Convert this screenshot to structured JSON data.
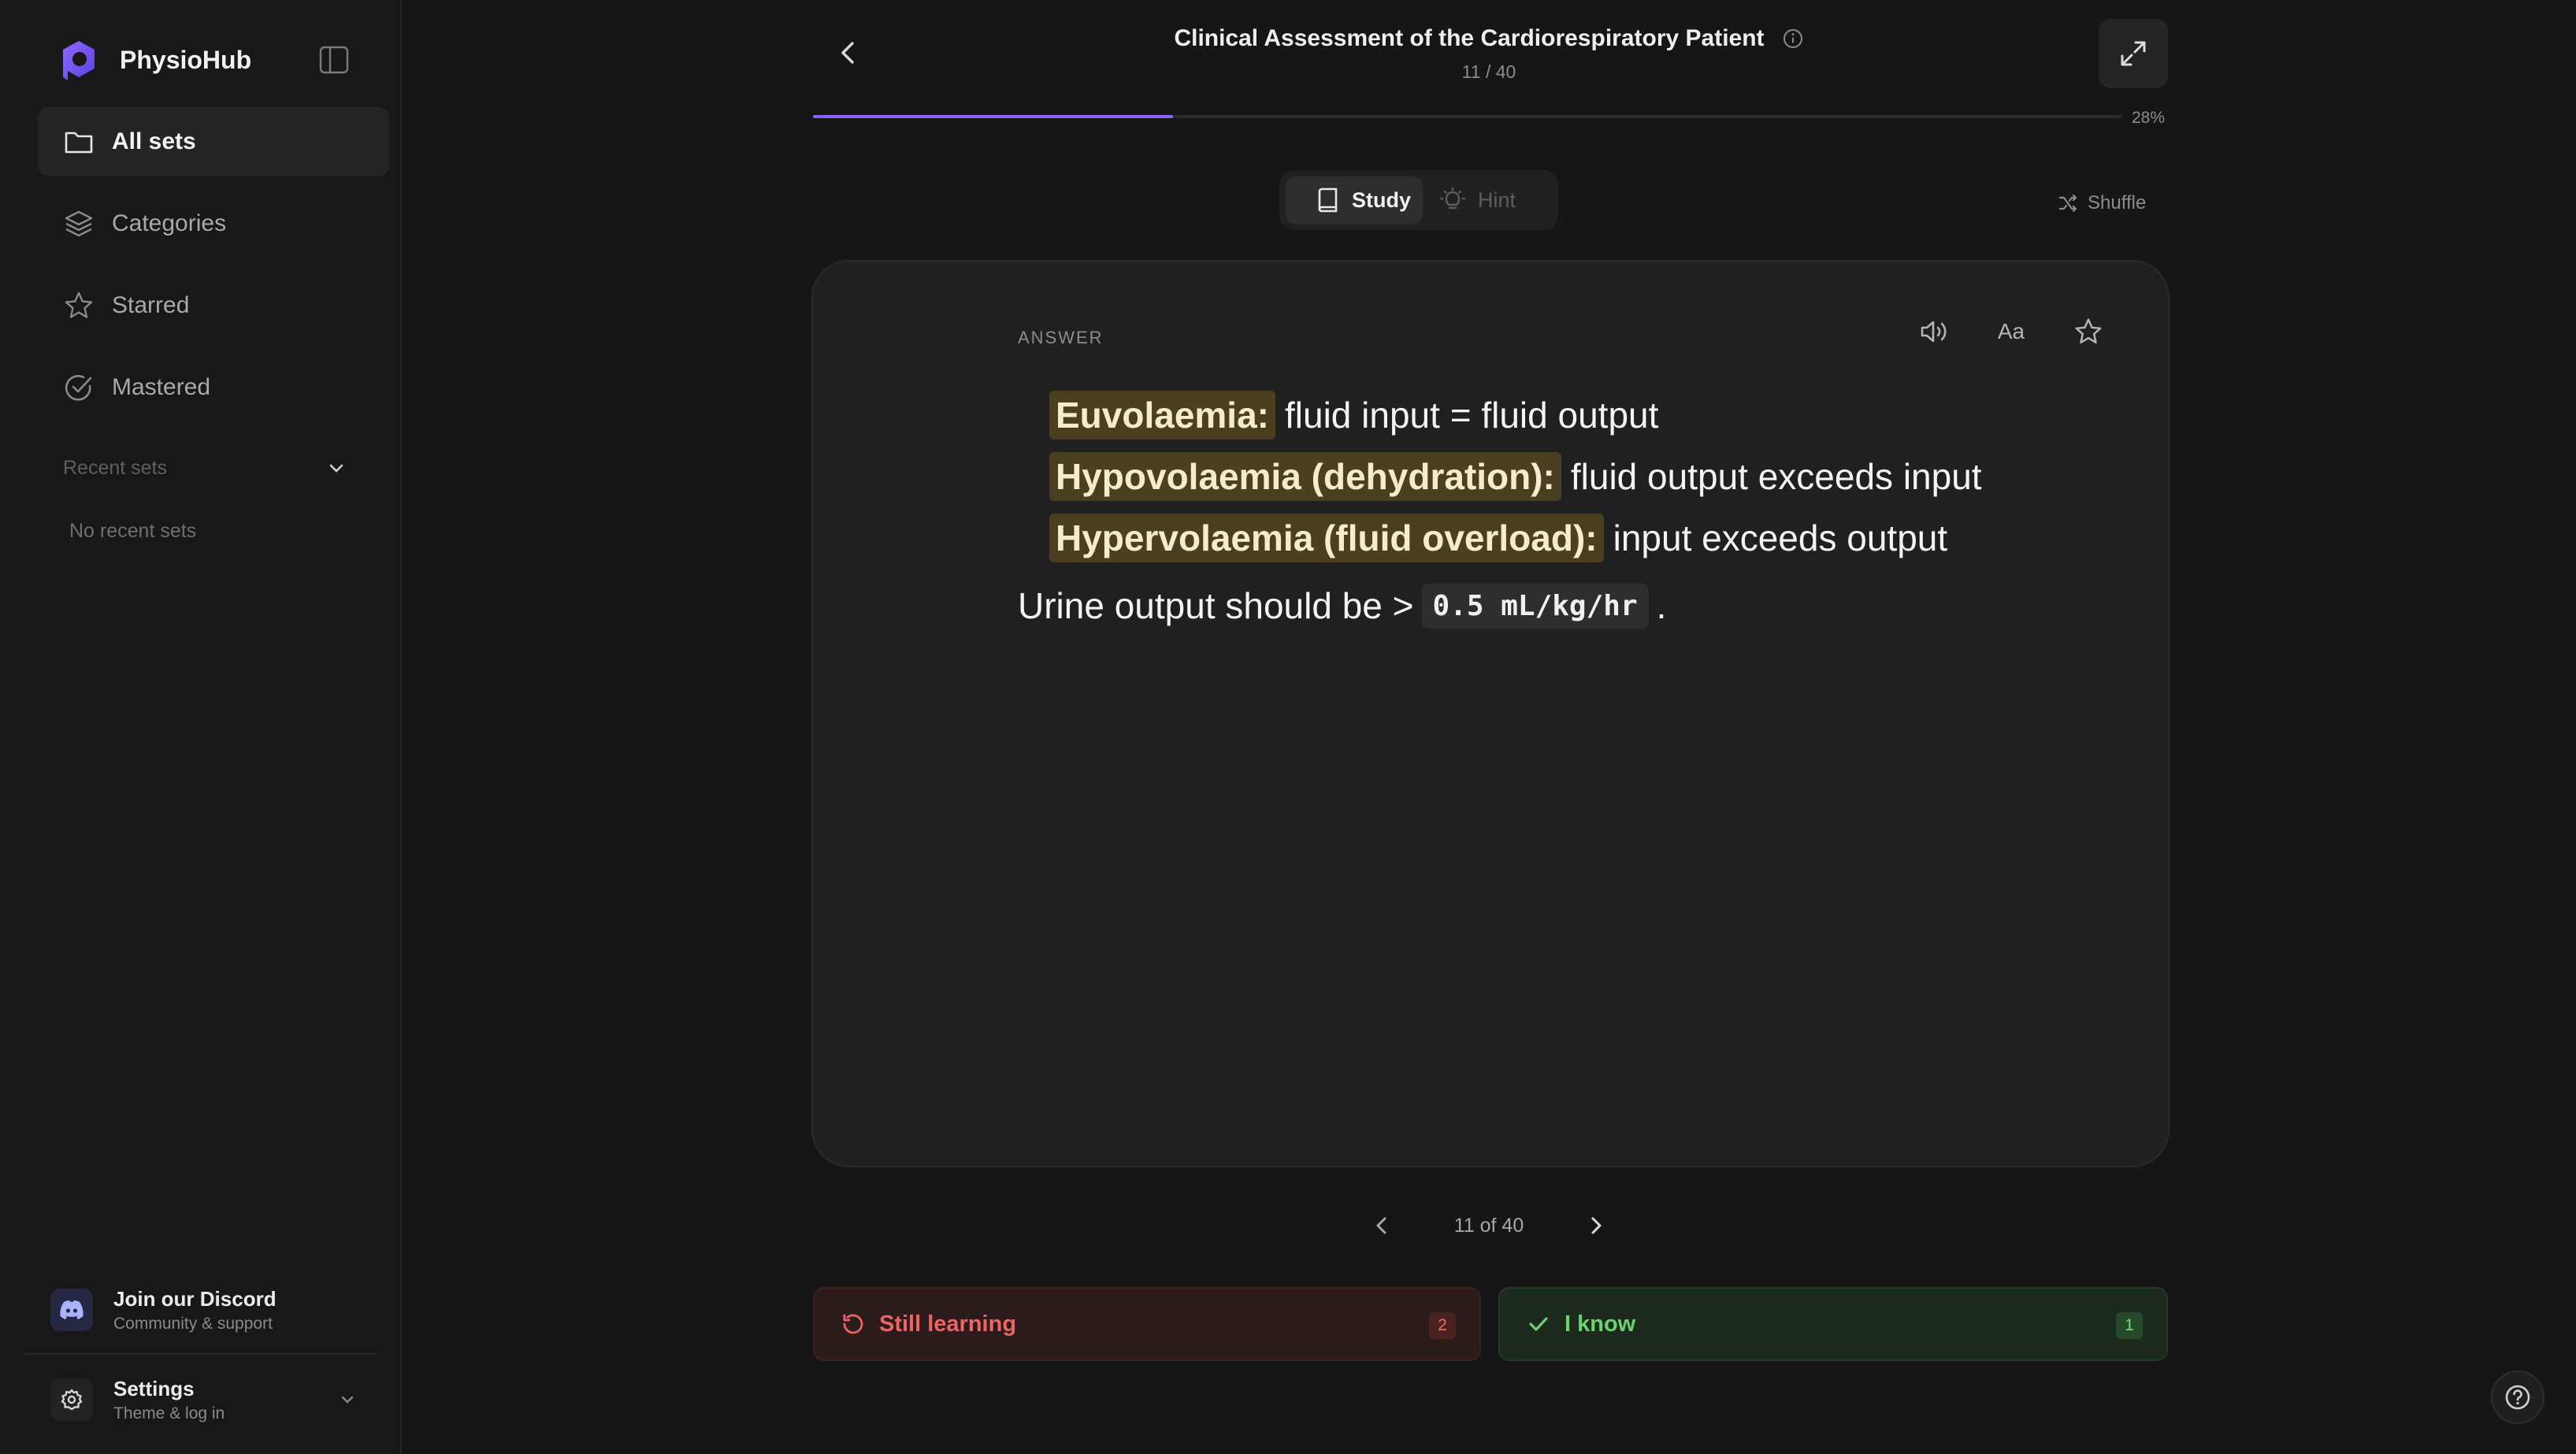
{
  "app": {
    "name": "PhysioHub",
    "brand_color": "#7c5cff"
  },
  "sidebar": {
    "items": [
      {
        "label": "All sets",
        "icon": "folder-icon",
        "active": true
      },
      {
        "label": "Categories",
        "icon": "layers-icon",
        "active": false
      },
      {
        "label": "Starred",
        "icon": "star-icon",
        "active": false
      },
      {
        "label": "Mastered",
        "icon": "check-circle-icon",
        "active": false
      }
    ],
    "recent_title": "Recent sets",
    "recent_empty": "No recent sets",
    "discord": {
      "title": "Join our Discord",
      "subtitle": "Community & support"
    },
    "settings": {
      "title": "Settings",
      "subtitle": "Theme & log in"
    }
  },
  "header": {
    "title": "Clinical Assessment of the Cardiorespiratory Patient",
    "counter": "11 / 40",
    "progress_pct": "28%",
    "progress_fraction": 0.275
  },
  "modes": {
    "study": "Study",
    "hint": "Hint",
    "shuffle": "Shuffle"
  },
  "card": {
    "label": "ANSWER",
    "font_tool": "Aa",
    "lines": [
      {
        "term": "Euvolaemia:",
        "text": "fluid input = fluid output"
      },
      {
        "term": "Hypovolaemia (dehydration):",
        "text": "fluid output exceeds input"
      },
      {
        "term": "Hypervolaemia (fluid overload):",
        "text": "input exceeds output"
      }
    ],
    "urine_prefix": "Urine output should be >",
    "urine_code": "0.5 mL/kg/hr",
    "urine_suffix": "."
  },
  "pager": {
    "text": "11 of 40"
  },
  "actions": {
    "still_learning": "Still learning",
    "still_count": "2",
    "i_know": "I know",
    "know_count": "1"
  },
  "colors": {
    "accent": "#8a63ff",
    "still": "#ec6464",
    "know": "#69d46f",
    "highlight": "#4a3f21"
  }
}
